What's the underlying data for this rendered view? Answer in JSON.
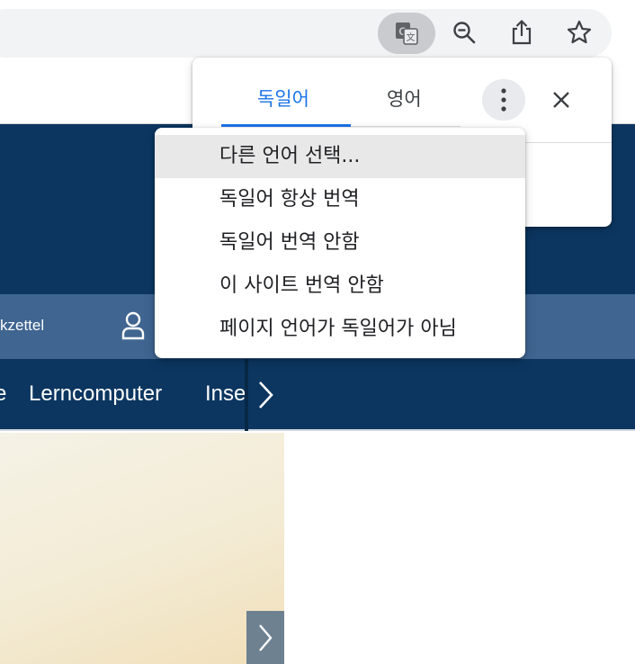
{
  "toolbar": {
    "icons": [
      "translate-icon",
      "zoom-out-icon",
      "share-icon",
      "star-icon"
    ]
  },
  "translate_bubble": {
    "tabs": [
      {
        "label": "독일어",
        "active": true
      },
      {
        "label": "영어",
        "active": false
      }
    ],
    "menu": {
      "items": [
        {
          "label": "다른 언어 선택..."
        },
        {
          "label": "독일어 항상 번역"
        },
        {
          "label": "독일어 번역 안함"
        },
        {
          "label": "이 사이트 번역 안함"
        },
        {
          "label": "페이지 언어가 독일어가 아님"
        }
      ]
    }
  },
  "site": {
    "subbar_text": "kzettel",
    "nav": [
      {
        "label": "e"
      },
      {
        "label": "Lerncomputer"
      },
      {
        "label": "Inse"
      }
    ]
  },
  "colors": {
    "accent": "#1a73e8",
    "site_primary": "#0c3660",
    "site_subbar": "#3f6590"
  }
}
